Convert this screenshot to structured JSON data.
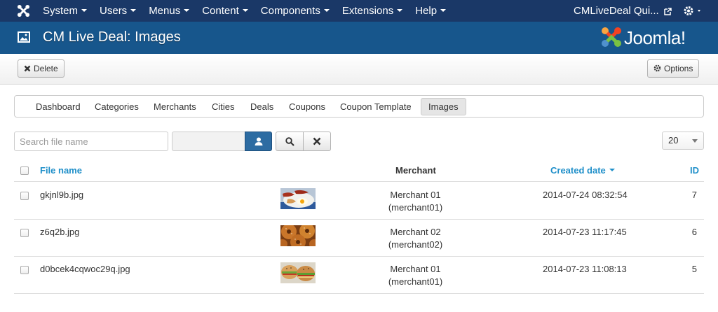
{
  "topbar": {
    "menu": [
      "System",
      "Users",
      "Menus",
      "Content",
      "Components",
      "Extensions",
      "Help"
    ],
    "site_name": "CMLiveDeal Qui...",
    "icons": [
      "joomla-logo-icon",
      "external-link-icon",
      "gear-icon"
    ]
  },
  "header": {
    "title": "CM Live Deal: Images",
    "brand": "Joomla!",
    "colors": {
      "nav": "#1a3867",
      "title_bar": "#17568c"
    }
  },
  "toolbar": {
    "delete_label": "Delete",
    "options_label": "Options"
  },
  "subnav": {
    "tabs": [
      "Dashboard",
      "Categories",
      "Merchants",
      "Cities",
      "Deals",
      "Coupons",
      "Coupon Template",
      "Images"
    ],
    "active": "Images"
  },
  "filters": {
    "search_placeholder": "Search file name",
    "limit": "20"
  },
  "table": {
    "headers": {
      "filename": "File name",
      "merchant": "Merchant",
      "created": "Created date",
      "id": "ID"
    },
    "sorted_by": "Created date",
    "sort_direction": "descending",
    "rows": [
      {
        "filename": "gkjnl9b.jpg",
        "merchant": "Merchant 01",
        "alias": "(merchant01)",
        "created": "2014-07-24 08:32:54",
        "id": "7",
        "thumb": "breakfast-plate"
      },
      {
        "filename": "z6q2b.jpg",
        "merchant": "Merchant 02",
        "alias": "(merchant02)",
        "created": "2014-07-23 11:17:45",
        "id": "6",
        "thumb": "bagels"
      },
      {
        "filename": "d0bcek4cqwoc29q.jpg",
        "merchant": "Merchant 01",
        "alias": "(merchant01)",
        "created": "2014-07-23 11:08:13",
        "id": "5",
        "thumb": "sandwiches"
      }
    ]
  }
}
